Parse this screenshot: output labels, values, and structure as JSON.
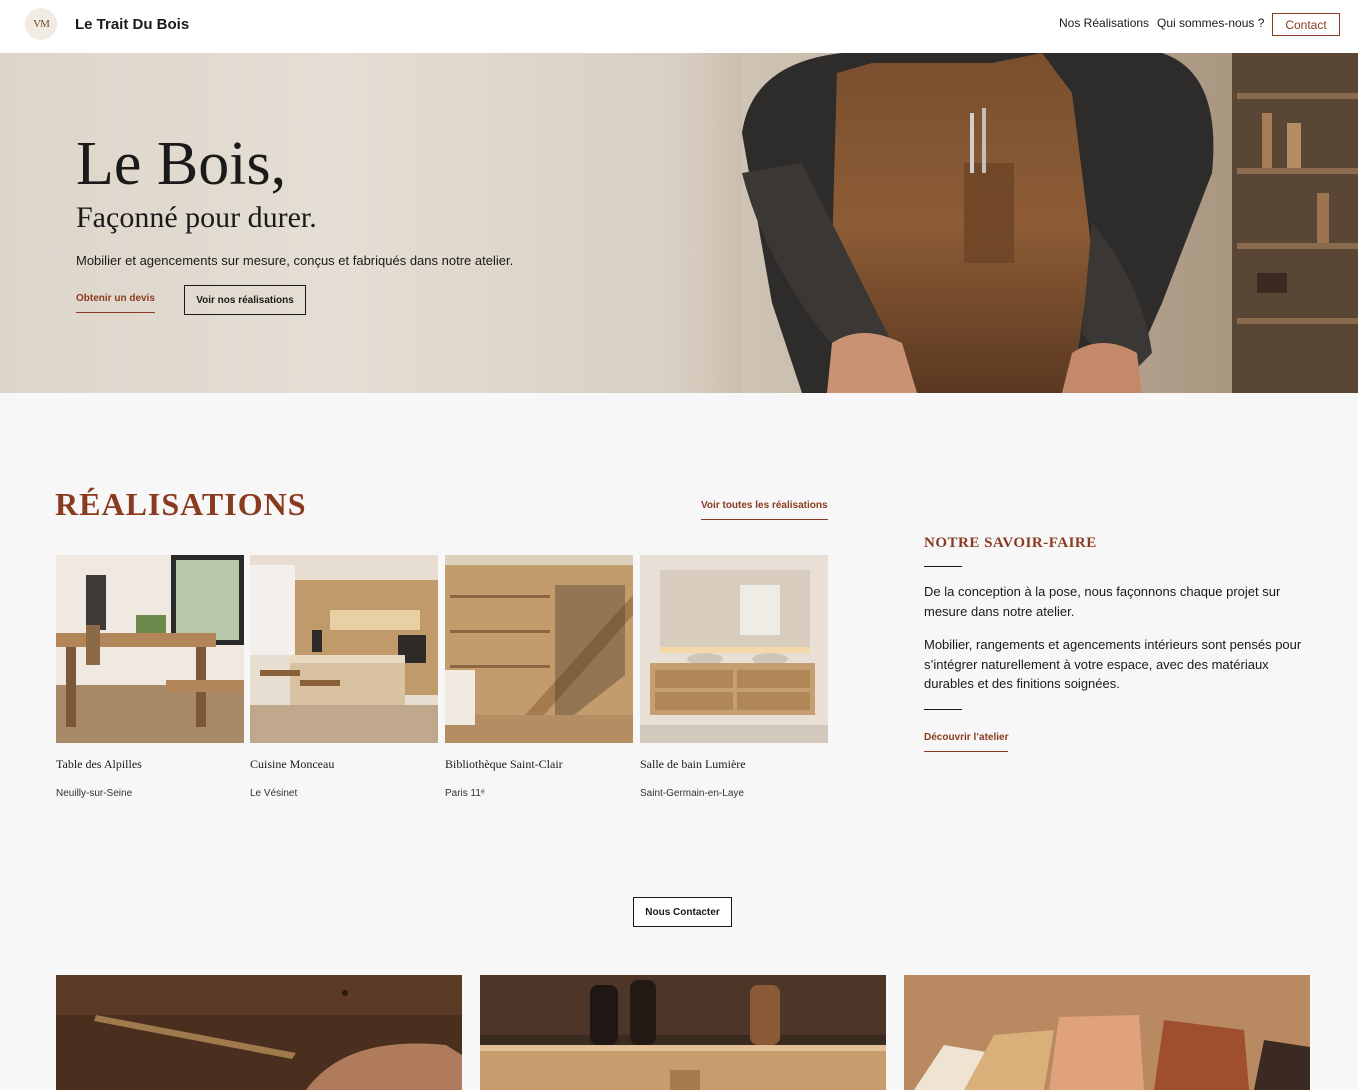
{
  "header": {
    "logo_text": "VM",
    "brand": "Le Trait Du Bois",
    "nav": {
      "realisations": "Nos Réalisations",
      "about": "Qui sommes-nous ?",
      "contact": "Contact"
    }
  },
  "hero": {
    "title": "Le Bois,",
    "subtitle": "Façonné pour durer.",
    "text": "Mobilier et agencements sur mesure, conçus et fabriqués dans notre atelier.",
    "cta_quote": "Obtenir un devis",
    "cta_works": "Voir nos réalisations"
  },
  "realisations": {
    "title": "RÉALISATIONS",
    "see_all": "Voir toutes les réalisations",
    "items": [
      {
        "title": "Table des Alpilles",
        "location": "Neuilly-sur-Seine"
      },
      {
        "title": "Cuisine Monceau",
        "location": "Le Vésinet"
      },
      {
        "title": "Bibliothèque Saint-Clair",
        "location": "Paris 11ᵉ"
      },
      {
        "title": "Salle de bain Lumière",
        "location": "Saint-Germain-en-Laye"
      }
    ]
  },
  "savoir_faire": {
    "title": "NOTRE SAVOIR-FAIRE",
    "p1": "De la conception à la pose, nous façonnons chaque projet sur mesure dans notre atelier.",
    "p2": "Mobilier, rangements et agencements intérieurs sont pensés pour s’intégrer naturellement à votre espace, avec des matériaux durables et des finitions soignées.",
    "link": "Découvrir l’atelier"
  },
  "contact_button": "Nous Contacter",
  "colors": {
    "accent": "#8a3b1f",
    "background": "#f7f7f7",
    "text": "#1a1a1a"
  }
}
